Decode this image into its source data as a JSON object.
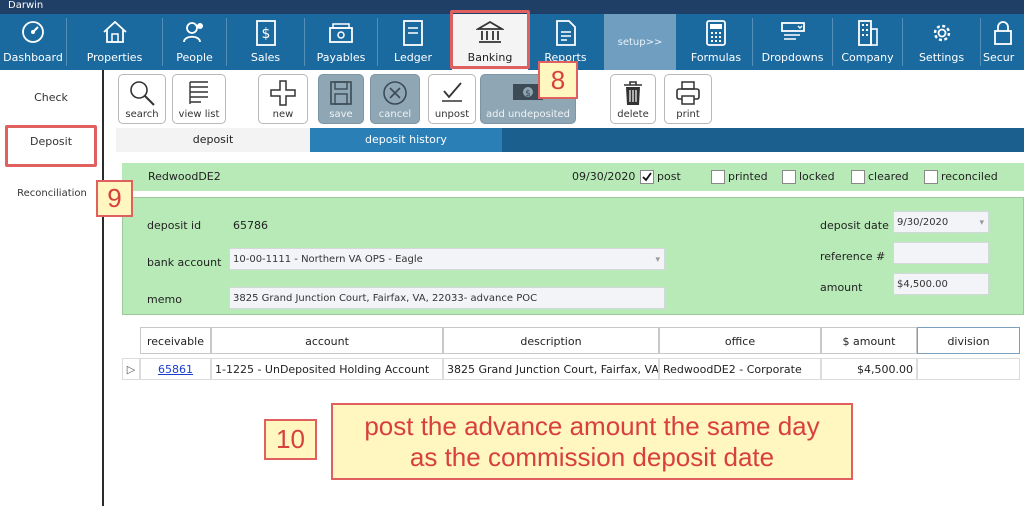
{
  "app": {
    "title": "Darwin"
  },
  "nav": {
    "items": [
      {
        "label": "Dashboard",
        "icon": "gauge-icon"
      },
      {
        "label": "Properties",
        "icon": "house-icon"
      },
      {
        "label": "People",
        "icon": "people-icon"
      },
      {
        "label": "Sales",
        "icon": "dollar-doc-icon"
      },
      {
        "label": "Payables",
        "icon": "cash-icon"
      },
      {
        "label": "Ledger",
        "icon": "ledger-icon"
      },
      {
        "label": "Banking",
        "icon": "bank-icon"
      },
      {
        "label": "Reports",
        "icon": "report-icon"
      },
      {
        "label": "setup>>",
        "icon": ""
      },
      {
        "label": "Formulas",
        "icon": "calculator-icon"
      },
      {
        "label": "Dropdowns",
        "icon": "dropdown-icon"
      },
      {
        "label": "Company",
        "icon": "building-icon"
      },
      {
        "label": "Settings",
        "icon": "gear-icon"
      },
      {
        "label": "Secur",
        "icon": "lock-icon"
      }
    ]
  },
  "sidebar": {
    "items": [
      {
        "label": "Check"
      },
      {
        "label": "Deposit"
      },
      {
        "label": "Reconciliation"
      }
    ]
  },
  "toolbar": {
    "search": "search",
    "view_list": "view list",
    "new": "new",
    "save": "save",
    "cancel": "cancel",
    "unpost": "unpost",
    "add_undeposited": "add undeposited",
    "delete": "delete",
    "print": "print"
  },
  "tabs": {
    "deposit": "deposit",
    "deposit_history": "deposit history"
  },
  "header": {
    "entity": "RedwoodDE2",
    "date": "09/30/2020",
    "post": "post",
    "printed": "printed",
    "locked": "locked",
    "cleared": "cleared",
    "reconciled": "reconciled",
    "post_checked": true
  },
  "form": {
    "deposit_id_label": "deposit id",
    "deposit_id": "65786",
    "bank_account_label": "bank account",
    "bank_account": "10-00-1111 - Northern VA OPS - Eagle",
    "memo_label": "memo",
    "memo": "3825 Grand Junction Court, Fairfax, VA, 22033- advance POC",
    "deposit_date_label": "deposit date",
    "deposit_date": "9/30/2020",
    "reference_label": "reference #",
    "reference": "",
    "amount_label": "amount",
    "amount": "$4,500.00"
  },
  "grid": {
    "columns": [
      "receivable",
      "account",
      "description",
      "office",
      "$ amount",
      "division"
    ],
    "rows": [
      {
        "receivable": "65861",
        "account": "1-1225 - UnDeposited Holding Account",
        "description": "3825 Grand Junction Court, Fairfax, VA...",
        "office": "RedwoodDE2 - Corporate",
        "amount": "$4,500.00",
        "division": ""
      }
    ]
  },
  "annotations": {
    "n8": "8",
    "n9": "9",
    "n10": "10",
    "note_line1": "post the advance amount the same day",
    "note_line2": "as the commission deposit date"
  },
  "colors": {
    "nav_bg": "#1a6aa0",
    "tab_bar": "#1b5f8e",
    "form_green": "#b8eab8",
    "callout_red": "#e0605f",
    "callout_fill": "#fff6c0",
    "link_blue": "#1a3fd0"
  }
}
